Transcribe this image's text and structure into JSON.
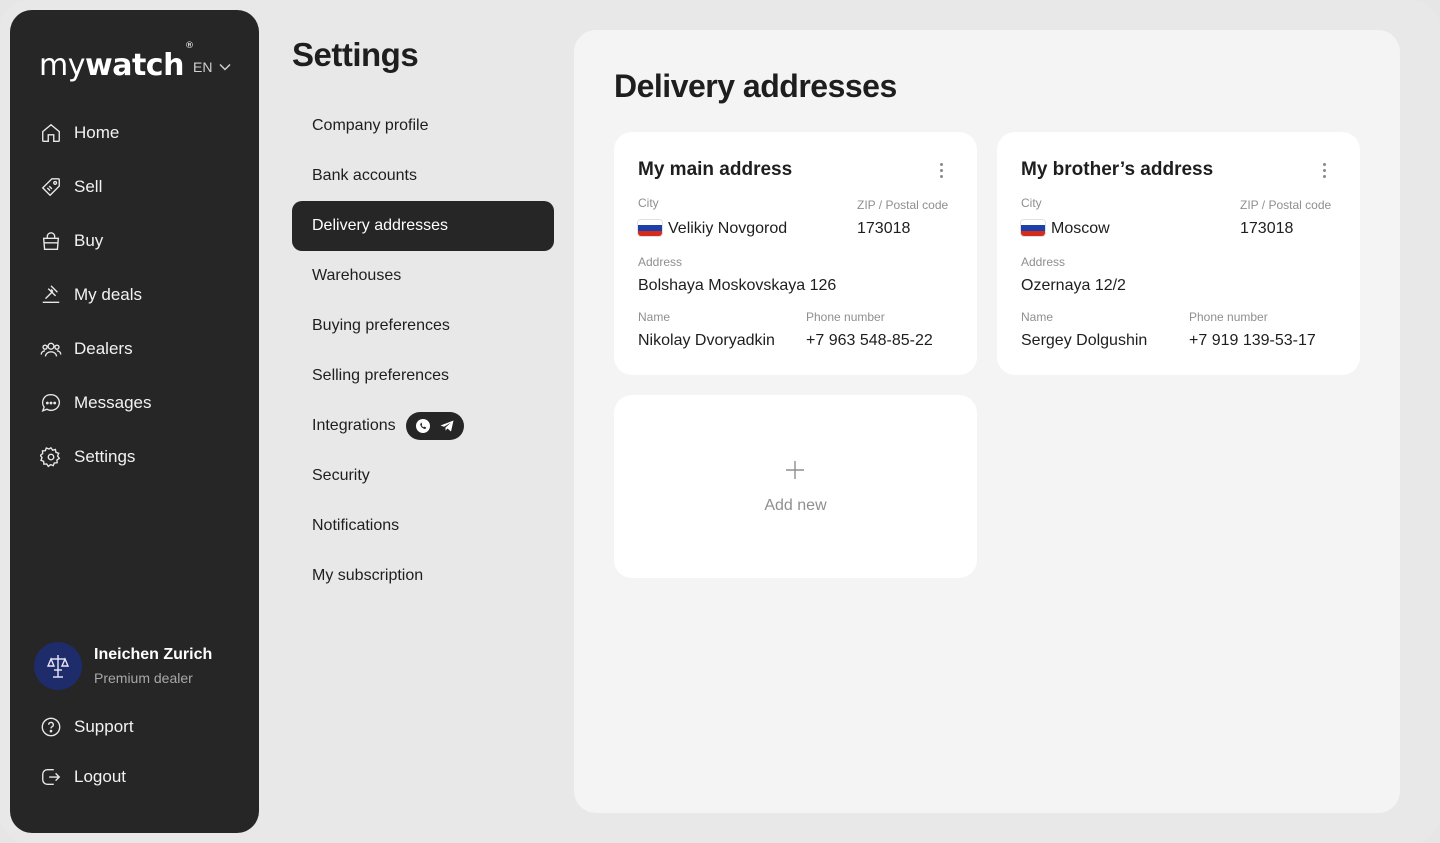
{
  "sidebar": {
    "logo": {
      "light": "my",
      "bold": "watch",
      "mark": "®"
    },
    "language": "EN",
    "nav": [
      {
        "label": "Home",
        "icon": "home-icon"
      },
      {
        "label": "Sell",
        "icon": "tag-icon"
      },
      {
        "label": "Buy",
        "icon": "shopping-bag-icon"
      },
      {
        "label": "My deals",
        "icon": "handshake-icon"
      },
      {
        "label": "Dealers",
        "icon": "users-icon"
      },
      {
        "label": "Messages",
        "icon": "chat-bubble-icon"
      },
      {
        "label": "Settings",
        "icon": "gear-icon"
      }
    ],
    "profile": {
      "name": "Ineichen Zurich",
      "role": "Premium dealer"
    },
    "bottom": [
      {
        "label": "Support",
        "icon": "help-circle-icon"
      },
      {
        "label": "Logout",
        "icon": "logout-icon"
      }
    ]
  },
  "settings": {
    "title": "Settings",
    "menu": [
      {
        "label": "Company profile"
      },
      {
        "label": "Bank accounts"
      },
      {
        "label": "Delivery addresses",
        "active": true
      },
      {
        "label": "Warehouses"
      },
      {
        "label": "Buying preferences"
      },
      {
        "label": "Selling preferences"
      },
      {
        "label": "Integrations",
        "badge_icons": [
          "whatsapp-icon",
          "telegram-icon"
        ]
      },
      {
        "label": "Security"
      },
      {
        "label": "Notifications"
      },
      {
        "label": "My subscription"
      }
    ]
  },
  "main": {
    "title": "Delivery addresses",
    "labels": {
      "city": "City",
      "zip": "ZIP / Postal code",
      "address": "Address",
      "name": "Name",
      "phone": "Phone number"
    },
    "addresses": [
      {
        "title": "My main address",
        "city": "Velikiy Novgorod",
        "flag": "russia-flag",
        "zip": "173018",
        "address": "Bolshaya Moskovskaya 126",
        "name": "Nikolay Dvoryadkin",
        "phone": "+7 963 548-85-22"
      },
      {
        "title": "My brother’s address",
        "city": "Moscow",
        "flag": "russia-flag",
        "zip": "173018",
        "address": "Ozernaya 12/2",
        "name": "Sergey Dolgushin",
        "phone": "+7 919 139-53-17"
      }
    ],
    "add_new": "Add new"
  },
  "colors": {
    "sidebar_bg": "#262626",
    "page_bg": "#e8e8e8",
    "panel_bg": "#f4f4f4",
    "card_bg": "#ffffff",
    "active_menu_bg": "#262626",
    "avatar_bg": "#1f2c6b",
    "muted_text": "#8f8f8f"
  }
}
